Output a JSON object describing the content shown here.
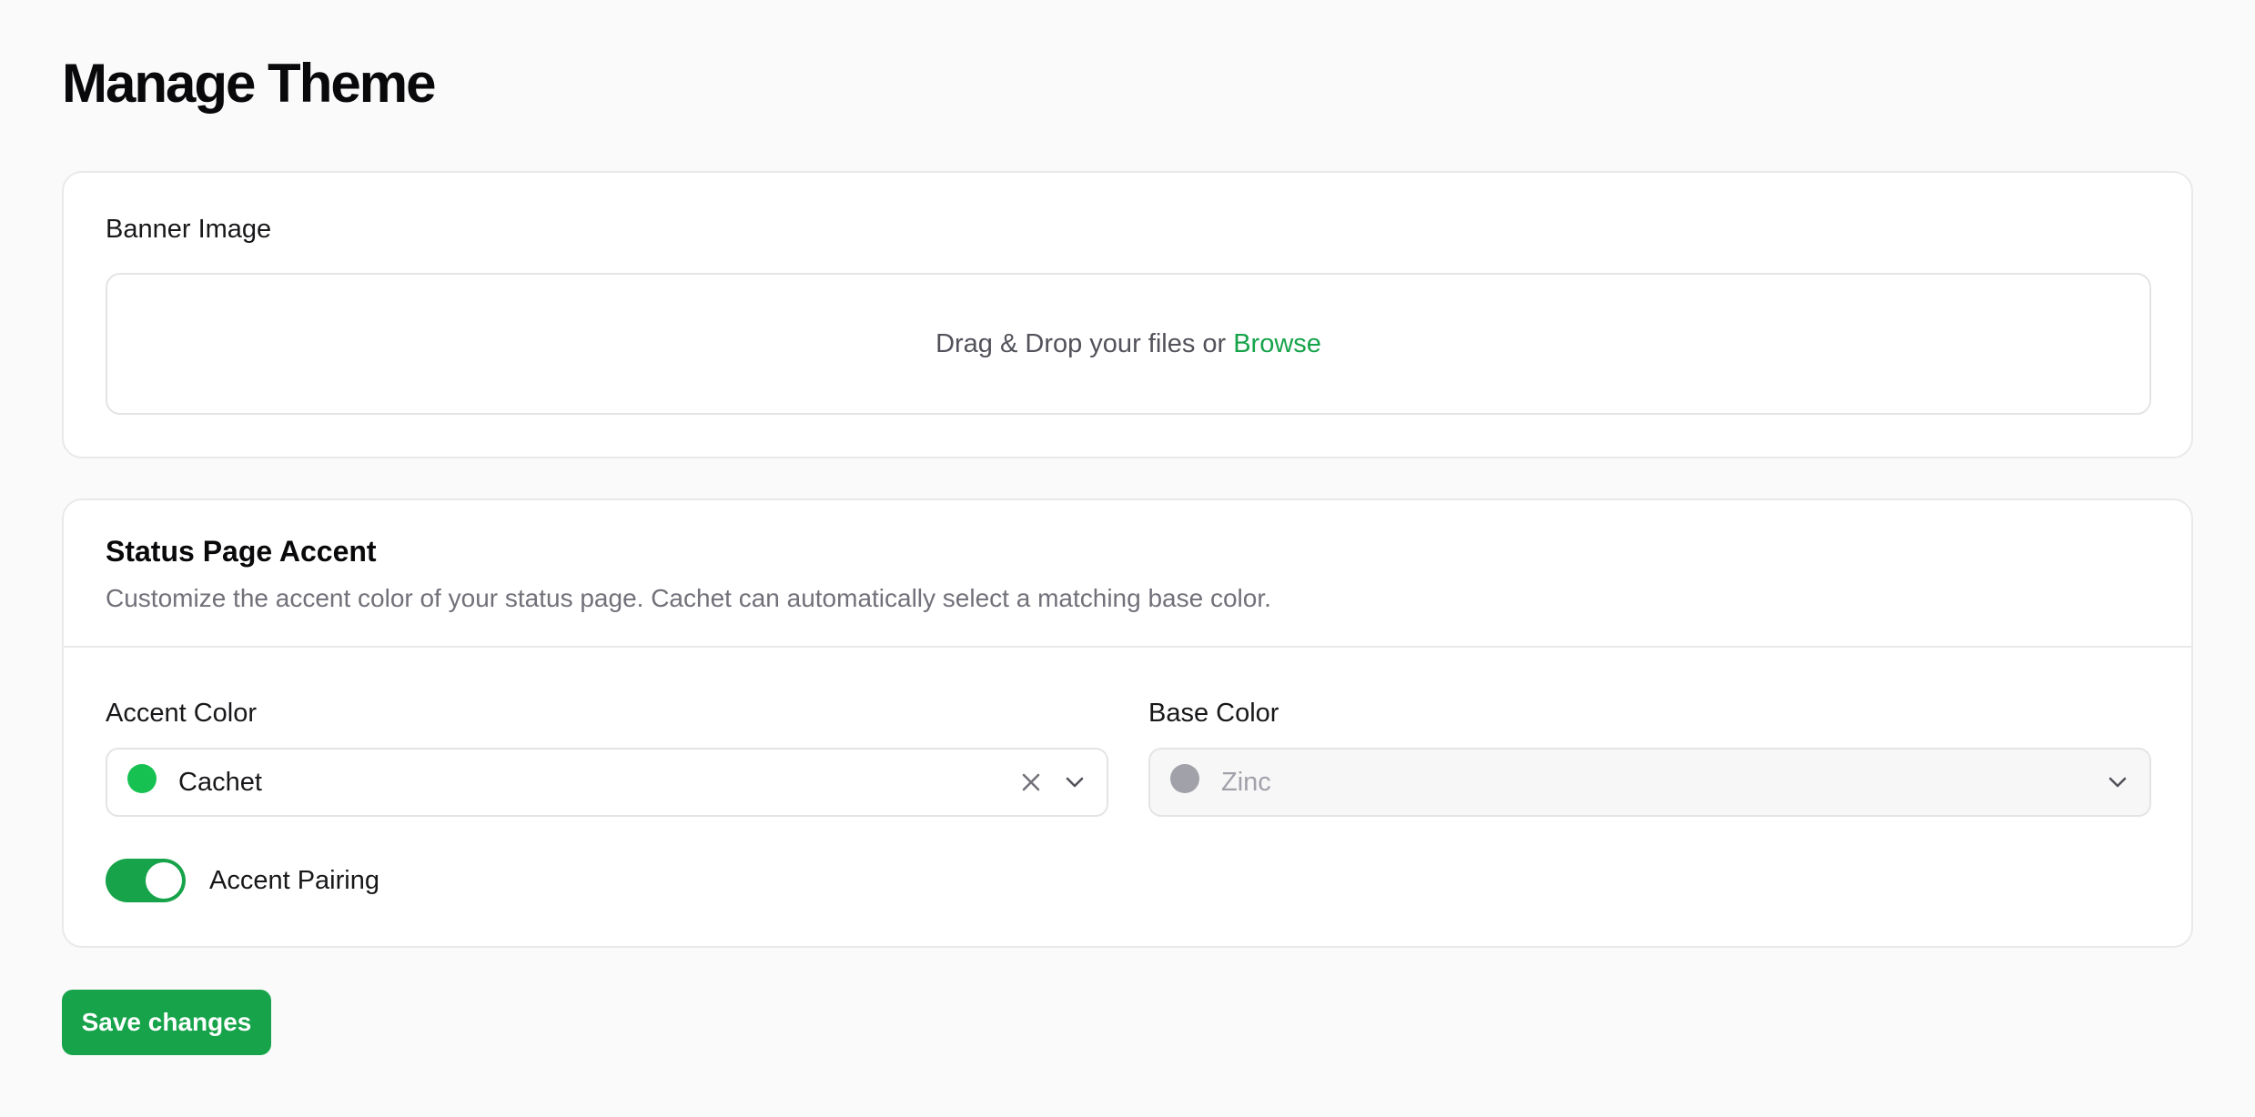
{
  "page": {
    "title": "Manage Theme"
  },
  "banner": {
    "label": "Banner Image",
    "dropzone_text": "Drag & Drop your files or",
    "browse_label": "Browse"
  },
  "accent_section": {
    "title": "Status Page Accent",
    "description": "Customize the accent color of your status page. Cachet can automatically select a matching base color.",
    "accent_color": {
      "label": "Accent Color",
      "value": "Cachet",
      "swatch_color": "#16c152"
    },
    "base_color": {
      "label": "Base Color",
      "value": "Zinc",
      "swatch_color": "#a1a1aa",
      "disabled": true
    },
    "accent_pairing": {
      "label": "Accent Pairing",
      "enabled": true
    }
  },
  "actions": {
    "save_label": "Save changes"
  },
  "colors": {
    "primary": "#16a34a",
    "background": "#fafafa",
    "card": "#ffffff",
    "border": "#e9e9ec"
  },
  "icons": {
    "clear": "close-icon",
    "dropdown": "chevron-down-icon"
  }
}
